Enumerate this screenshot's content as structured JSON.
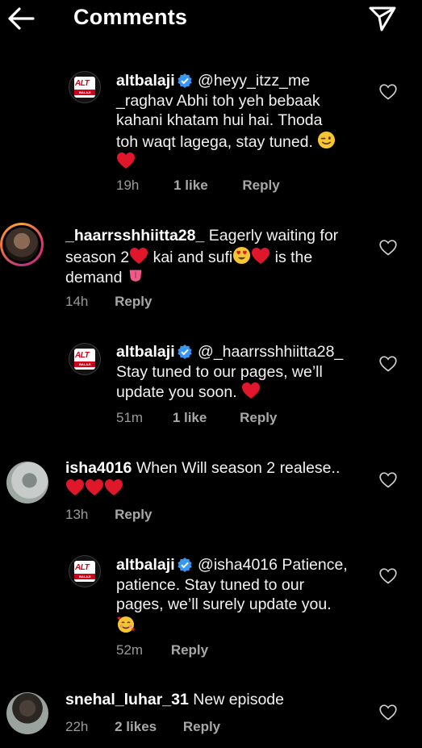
{
  "header": {
    "title": "Comments",
    "back_icon": "arrow-left-icon",
    "share_icon": "paper-plane-icon"
  },
  "colors": {
    "background": "#000000",
    "verified": "#3897f0",
    "heart": "#e0162b",
    "muted": "#9a9a9a"
  },
  "comments": [
    {
      "username": "altbalaji",
      "verified": true,
      "mention": "@heyy_itzz_me",
      "text_lines": [
        "_raghav Abhi toh yeh bebaak",
        "kahani khatam hui hai. Thoda",
        "toh waqt lagega, stay tuned."
      ],
      "time": "19h",
      "likes": "1 like",
      "reply": "Reply"
    },
    {
      "username": "_haarrsshhiitta28_",
      "verified": false,
      "text_line1": "Eagerly waiting for",
      "text_line2a": "season 2",
      "text_line2b": " kai and sufi",
      "text_line2c": " is the",
      "text_line3": "demand",
      "time": "14h",
      "reply": "Reply"
    },
    {
      "username": "altbalaji",
      "verified": true,
      "mention": "@_haarrsshhiitta28_",
      "text_lines": [
        "Stay tuned to our pages, we’ll",
        "update you soon."
      ],
      "time": "51m",
      "likes": "1 like",
      "reply": "Reply"
    },
    {
      "username": "isha4016",
      "verified": false,
      "text": "When Will season 2 realese..",
      "time": "13h",
      "reply": "Reply"
    },
    {
      "username": "altbalaji",
      "verified": true,
      "mention": "@isha4016",
      "text_first": "Patience,",
      "text_lines": [
        "patience. Stay tuned to our",
        "pages, we’ll surely update you."
      ],
      "time": "52m",
      "reply": "Reply"
    },
    {
      "username": "snehal_luhar_31",
      "verified": false,
      "text": "New episode",
      "time": "22h",
      "likes": "2 likes",
      "reply": "Reply"
    }
  ]
}
